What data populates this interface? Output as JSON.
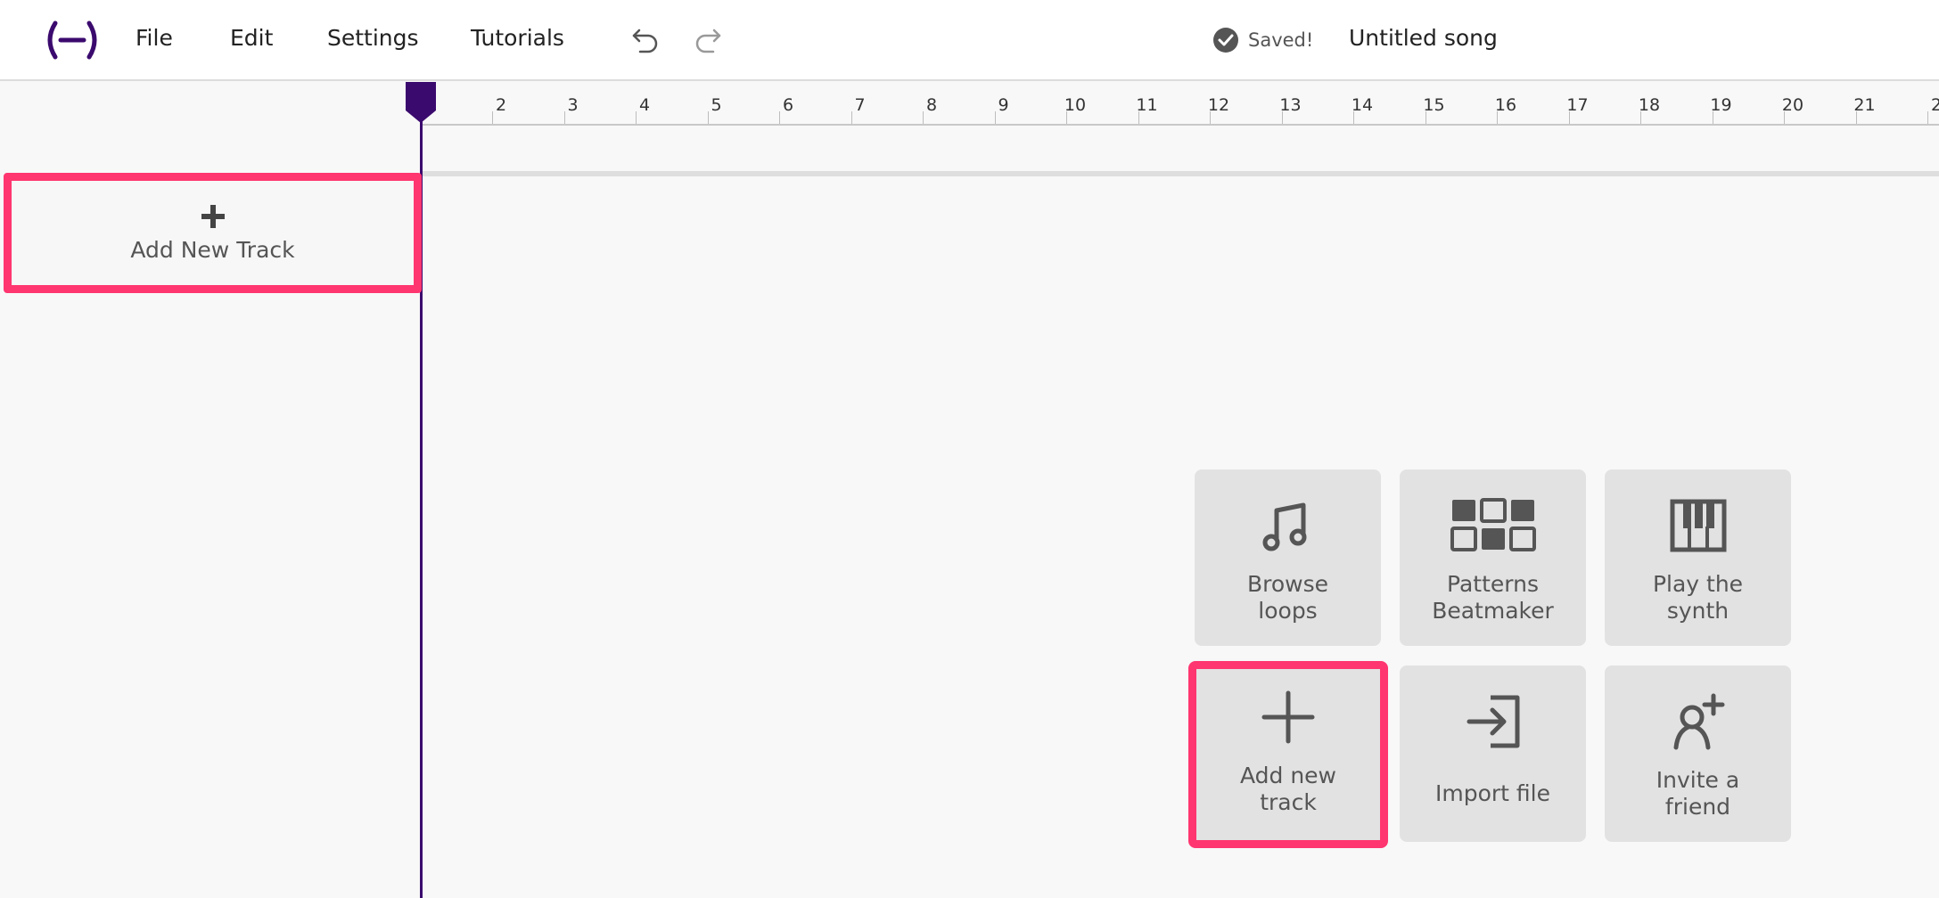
{
  "header": {
    "menu": [
      "File",
      "Edit",
      "Settings",
      "Tutorials"
    ],
    "saved_label": "Saved!",
    "song_title": "Untitled song"
  },
  "ruler": {
    "bars": [
      "2",
      "3",
      "4",
      "5",
      "6",
      "7",
      "8",
      "9",
      "10",
      "11",
      "12",
      "13",
      "14",
      "15",
      "16",
      "17",
      "18",
      "19",
      "20",
      "21",
      "2"
    ]
  },
  "sidebar": {
    "add_track_label": "Add New Track"
  },
  "tiles": [
    {
      "id": "browse-loops",
      "label": "Browse\nloops",
      "icon": "music-note-icon"
    },
    {
      "id": "patterns-beatmaker",
      "label": "Patterns\nBeatmaker",
      "icon": "grid-pads-icon"
    },
    {
      "id": "play-synth",
      "label": "Play the\nsynth",
      "icon": "piano-icon"
    },
    {
      "id": "add-new-track",
      "label": "Add new\ntrack",
      "icon": "plus-icon"
    },
    {
      "id": "import-file",
      "label": "Import file",
      "icon": "import-icon"
    },
    {
      "id": "invite-friend",
      "label": "Invite a\nfriend",
      "icon": "add-user-icon"
    }
  ],
  "colors": {
    "accent": "#3b0a6e",
    "highlight": "#ff3670",
    "tile_bg": "#e2e2e2"
  }
}
